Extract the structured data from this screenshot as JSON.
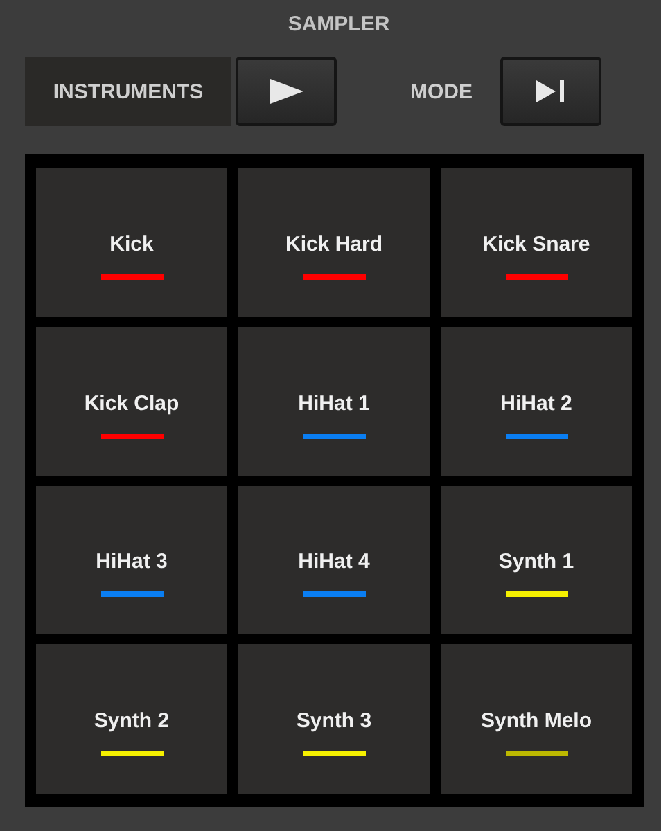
{
  "title": "SAMPLER",
  "controls": {
    "instruments_label": "INSTRUMENTS",
    "mode_label": "MODE"
  },
  "pads": [
    {
      "label": "Kick",
      "color": "#ff0000"
    },
    {
      "label": "Kick Hard",
      "color": "#ff0000"
    },
    {
      "label": "Kick Snare",
      "color": "#ff0000"
    },
    {
      "label": "Kick Clap",
      "color": "#ff0000"
    },
    {
      "label": "HiHat 1",
      "color": "#0a7ef2"
    },
    {
      "label": "HiHat 2",
      "color": "#0a7ef2"
    },
    {
      "label": "HiHat 3",
      "color": "#0a7ef2"
    },
    {
      "label": "HiHat 4",
      "color": "#0a7ef2"
    },
    {
      "label": "Synth 1",
      "color": "#f5f000"
    },
    {
      "label": "Synth 2",
      "color": "#f5f000"
    },
    {
      "label": "Synth 3",
      "color": "#f5f000"
    },
    {
      "label": "Synth Melo",
      "color": "#bcb800"
    }
  ]
}
